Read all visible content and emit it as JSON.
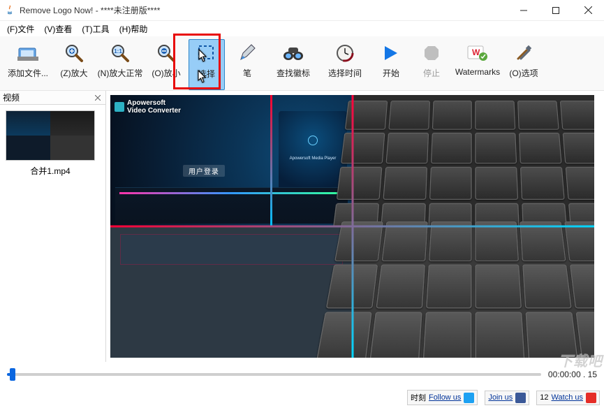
{
  "window": {
    "title": "Remove Logo Now! - ****未注册版****"
  },
  "menu": {
    "file": "(F)文件",
    "view": "(V)查看",
    "tools": "(T)工具",
    "help": "(H)帮助"
  },
  "toolbar": {
    "add_file": "添加文件...",
    "zoom_in": "(Z)放大",
    "zoom_normal": "(N)放大正常",
    "zoom_out": "(O)放小",
    "select": "选择",
    "pen": "笔",
    "find_logo": "查找徽标",
    "select_time": "选择时间",
    "start": "开始",
    "stop": "停止",
    "watermarks": "Watermarks",
    "options": "(O)选项"
  },
  "sidebar": {
    "title": "视频",
    "items": [
      {
        "filename": "合并1.mp4"
      }
    ]
  },
  "preview": {
    "overlay_brand": "Apowersoft",
    "overlay_sub": "Video Converter",
    "overlay_center": "用户登录",
    "ap_player": "Apowersoft Media Player"
  },
  "timeline": {
    "current": "00:00:00",
    "total": "15"
  },
  "status": {
    "label_left": "时刻",
    "follow": "Follow us",
    "join": "Join us",
    "watch_num": "12",
    "watch": "Watch us"
  },
  "watermark_corner": "下载吧"
}
